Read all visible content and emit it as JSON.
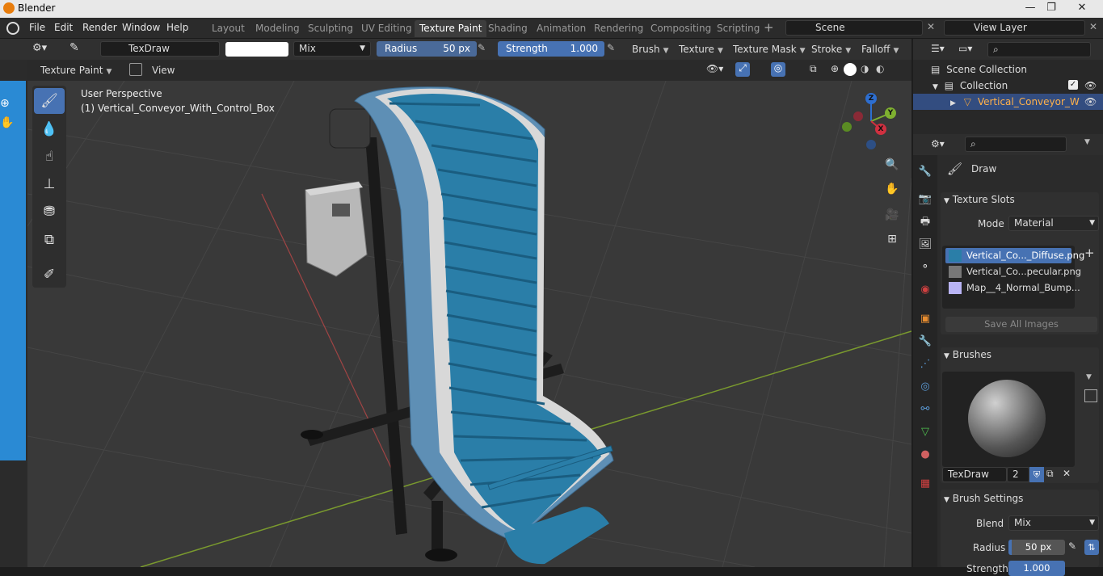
{
  "window": {
    "title": "Blender",
    "minimize": "—",
    "maximize": "❐",
    "close": "✕"
  },
  "menu": [
    "File",
    "Edit",
    "Render",
    "Window",
    "Help"
  ],
  "workspaces": [
    "Layout",
    "Modeling",
    "Sculpting",
    "UV Editing",
    "Texture Paint",
    "Shading",
    "Animation",
    "Rendering",
    "Compositing",
    "Scripting"
  ],
  "active_workspace": "Texture Paint",
  "scene": {
    "name": "Scene",
    "view_layer": "View Layer"
  },
  "tool_header": {
    "brush_name": "TexDraw",
    "blend_mode": "Mix",
    "radius_label": "Radius",
    "radius_value": "50 px",
    "strength_label": "Strength",
    "strength_value": "1.000",
    "menus": [
      "Brush",
      "Texture",
      "Texture Mask",
      "Stroke",
      "Falloff"
    ]
  },
  "viewport_header": {
    "mode": "Texture Paint",
    "view": "View"
  },
  "viewport": {
    "perspective": "User Perspective",
    "object_label": "(1) Vertical_Conveyor_With_Control_Box",
    "gizmo": {
      "z": "Z",
      "y": "Y",
      "x": "X"
    }
  },
  "outliner": {
    "scene_collection": "Scene Collection",
    "collection": "Collection",
    "object": "Vertical_Conveyor_W"
  },
  "properties": {
    "tool_name": "Draw",
    "texture_slots_title": "Texture Slots",
    "mode_label": "Mode",
    "mode_value": "Material",
    "slots": [
      "Vertical_Co..._Diffuse.png",
      "Vertical_Co...pecular.png",
      "Map__4_Normal_Bump..."
    ],
    "save_all": "Save All Images",
    "brushes_title": "Brushes",
    "brush_name": "TexDraw",
    "brush_users": "2",
    "brush_settings_title": "Brush Settings",
    "blend_label": "Blend",
    "blend_value": "Mix",
    "radius_label": "Radius",
    "radius_value": "50 px",
    "strength_label": "Strength",
    "strength_value": "1.000"
  },
  "colors": {
    "accent": "#4772b3",
    "belt": "#2a7ea8",
    "viewport_bg": "#393939",
    "panel": "#303030"
  }
}
